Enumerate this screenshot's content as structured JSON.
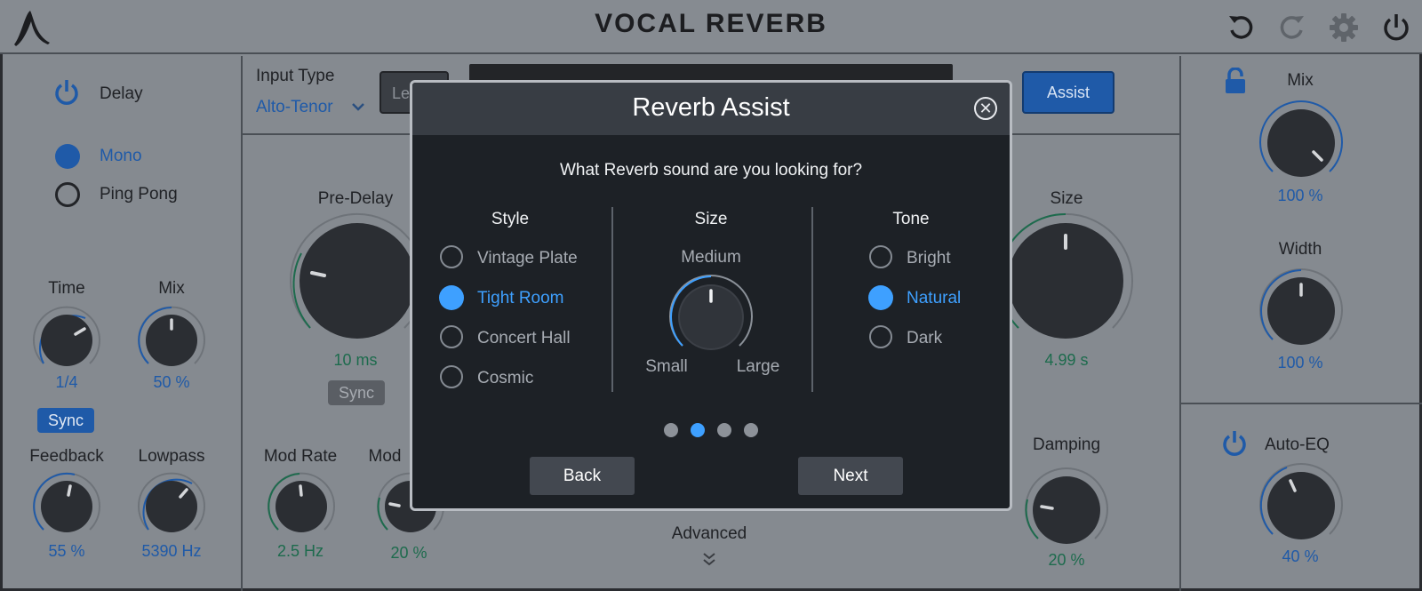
{
  "header": {
    "title": "VOCAL REVERB"
  },
  "left_panel": {
    "delay_label": "Delay",
    "mode_options": [
      "Mono",
      "Ping Pong"
    ],
    "selected_mode": "Mono",
    "time": {
      "label": "Time",
      "value": "1/4"
    },
    "mix": {
      "label": "Mix",
      "value": "50 %"
    },
    "sync_label": "Sync",
    "feedback": {
      "label": "Feedback",
      "value": "55 %"
    },
    "lowpass": {
      "label": "Lowpass",
      "value": "5390 Hz"
    }
  },
  "center_panel": {
    "input_type_label": "Input Type",
    "input_type_value": "Alto-Tenor",
    "learn_button_partial": "Le",
    "assist_button": "Assist",
    "pre_delay": {
      "label": "Pre-Delay",
      "value": "10 ms"
    },
    "pre_delay_sync": "Sync",
    "mod_rate": {
      "label": "Mod Rate",
      "value": "2.5 Hz"
    },
    "mod_depth": {
      "label": "Mod",
      "value": "20 %"
    },
    "size": {
      "label": "Size",
      "value": "4.99 s"
    },
    "damping": {
      "label": "Damping",
      "value": "20 %"
    },
    "advanced_label": "Advanced"
  },
  "right_panel": {
    "mix": {
      "label": "Mix",
      "value": "100 %"
    },
    "width": {
      "label": "Width",
      "value": "100 %"
    },
    "auto_eq": {
      "label": "Auto-EQ",
      "value": "40 %"
    }
  },
  "modal": {
    "title": "Reverb Assist",
    "question": "What Reverb sound are you looking for?",
    "style": {
      "heading": "Style",
      "options": [
        "Vintage Plate",
        "Tight Room",
        "Concert Hall",
        "Cosmic"
      ],
      "selected": "Tight Room"
    },
    "size": {
      "heading": "Size",
      "value": "Medium",
      "min_label": "Small",
      "max_label": "Large"
    },
    "tone": {
      "heading": "Tone",
      "options": [
        "Bright",
        "Natural",
        "Dark"
      ],
      "selected": "Natural"
    },
    "page": {
      "current": 2,
      "total": 4
    },
    "back_label": "Back",
    "next_label": "Next"
  },
  "colors": {
    "accent": "#3ea0ff",
    "background": "#858a90",
    "modal_background": "#1d2126",
    "value_blue": "#1f5aa8",
    "value_green": "#1d6b4d"
  },
  "icons": [
    "logo-icon",
    "undo-icon",
    "redo-icon",
    "gear-icon",
    "power-icon",
    "lock-icon",
    "chevron-down-icon",
    "double-chevron-down-icon",
    "close-icon"
  ]
}
